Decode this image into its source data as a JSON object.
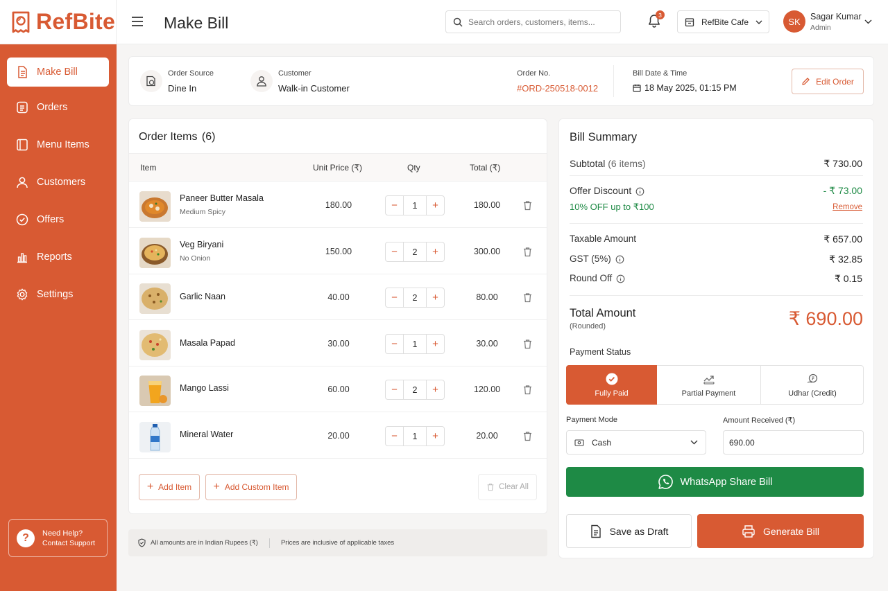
{
  "brand": {
    "name": "RefBite",
    "accent": "#d85a33",
    "green": "#1e8a45"
  },
  "header": {
    "title": "Make Bill",
    "search_placeholder": "Search orders, customers, items...",
    "notifications": "3",
    "outlet": "RefBite Cafe",
    "avatar": "SK",
    "user_name": "Sagar Kumar",
    "user_role": "Admin"
  },
  "sidebar": {
    "items": [
      {
        "label": "Make Bill",
        "icon": "bill-icon"
      },
      {
        "label": "Orders",
        "icon": "orders-icon"
      },
      {
        "label": "Menu Items",
        "icon": "menu-icon"
      },
      {
        "label": "Customers",
        "icon": "user-icon"
      },
      {
        "label": "Offers",
        "icon": "offer-icon"
      },
      {
        "label": "Reports",
        "icon": "reports-icon"
      },
      {
        "label": "Settings",
        "icon": "gear-icon"
      }
    ],
    "help_title": "Need Help?",
    "help_sub": "Contact Support"
  },
  "order_info": {
    "source_label": "Order Source",
    "source": "Dine In",
    "customer_label": "Customer",
    "customer": "Walk-in Customer",
    "order_no_label": "Order No.",
    "order_no": "#ORD-250518-0012",
    "date_label": "Bill Date & Time",
    "date": "18 May 2025, 01:15 PM",
    "edit_label": "Edit Order"
  },
  "items": {
    "title": "Order Items",
    "count": "(6)",
    "headers": {
      "item": "Item",
      "unit_price": "Unit Price (₹)",
      "qty": "Qty",
      "total": "Total (₹)"
    },
    "rows": [
      {
        "name": "Paneer Butter Masala",
        "note": "Medium Spicy",
        "price": "180.00",
        "qty": "1",
        "total": "180.00"
      },
      {
        "name": "Veg Biryani",
        "note": "No Onion",
        "price": "150.00",
        "qty": "2",
        "total": "300.00"
      },
      {
        "name": "Garlic Naan",
        "note": "",
        "price": "40.00",
        "qty": "2",
        "total": "80.00"
      },
      {
        "name": "Masala Papad",
        "note": "",
        "price": "30.00",
        "qty": "1",
        "total": "30.00"
      },
      {
        "name": "Mango Lassi",
        "note": "",
        "price": "60.00",
        "qty": "2",
        "total": "120.00"
      },
      {
        "name": "Mineral Water",
        "note": "",
        "price": "20.00",
        "qty": "1",
        "total": "20.00"
      }
    ],
    "add_item": "Add Item",
    "add_custom": "Add Custom Item",
    "clear_all": "Clear All"
  },
  "footer_note": {
    "currency": "All amounts are in Indian Rupees (₹)",
    "taxes": "Prices are inclusive of applicable taxes"
  },
  "summary": {
    "title": "Bill Summary",
    "subtotal_label": "Subtotal",
    "subtotal_count": "(6 items)",
    "subtotal": "₹ 730.00",
    "discount_label": "Offer Discount",
    "discount": "- ₹ 73.00",
    "discount_desc": "10% OFF up to ₹100",
    "remove": "Remove",
    "taxable_label": "Taxable Amount",
    "taxable": "₹ 657.00",
    "gst_label": "GST (5%)",
    "gst": "₹ 32.85",
    "round_label": "Round Off",
    "round": "₹ 0.15",
    "total_label": "Total Amount",
    "total_sub": "(Rounded)",
    "total": "₹ 690.00",
    "payment_status_label": "Payment Status",
    "payment_status": [
      {
        "label": "Fully Paid",
        "selected": true
      },
      {
        "label": "Partial Payment",
        "selected": false
      },
      {
        "label": "Udhar (Credit)",
        "selected": false
      }
    ],
    "payment_mode_label": "Payment Mode",
    "payment_mode": "Cash",
    "amount_received_label": "Amount Received (₹)",
    "amount_received": "690.00",
    "whatsapp": "WhatsApp Share Bill",
    "draft": "Save as Draft",
    "generate": "Generate Bill"
  }
}
